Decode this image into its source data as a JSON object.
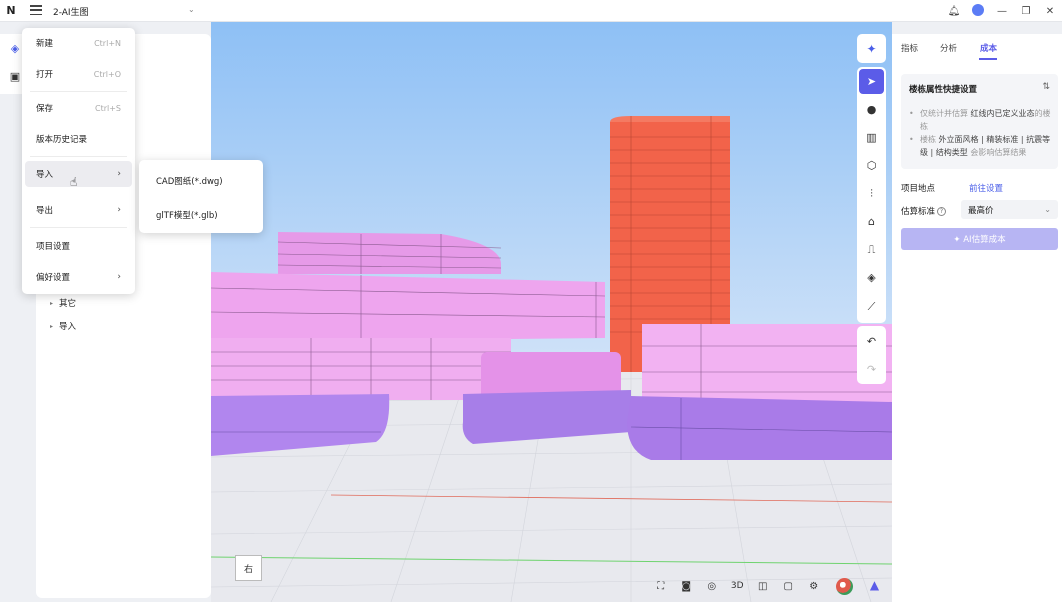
{
  "app": {
    "logo": "N",
    "project_title": "2-AI生图"
  },
  "titlebar_icons": [
    "bell-icon",
    "user-avatar",
    "minimize-icon",
    "maximize-icon",
    "close-icon"
  ],
  "left_tree": {
    "items": [
      {
        "label": "其它"
      },
      {
        "label": "导入"
      }
    ]
  },
  "main_menu": {
    "items": [
      {
        "label": "新建",
        "shortcut": "Ctrl+N"
      },
      {
        "label": "打开",
        "shortcut": "Ctrl+O"
      },
      {
        "label": "保存",
        "shortcut": "Ctrl+S"
      },
      {
        "label": "版本历史记录",
        "shortcut": ""
      },
      {
        "label": "导入",
        "shortcut": "",
        "submenu": true
      },
      {
        "label": "导出",
        "shortcut": "",
        "submenu": true
      },
      {
        "label": "项目设置",
        "shortcut": ""
      },
      {
        "label": "偏好设置",
        "shortcut": "",
        "submenu": true
      }
    ],
    "arrow": "›"
  },
  "import_submenu": {
    "items": [
      {
        "label": "CAD图纸(*.dwg)"
      },
      {
        "label": "glTF模型(*.glb)"
      }
    ]
  },
  "right_panel": {
    "tabs": [
      {
        "label": "指标"
      },
      {
        "label": "分析"
      },
      {
        "label": "成本",
        "active": true
      }
    ],
    "card": {
      "title": "楼栋属性快捷设置",
      "bullet1_a": "仅统计并估算 ",
      "bullet1_b": "红线内已定义业态",
      "bullet1_c": "的楼栋",
      "bullet2_a": "楼栋 ",
      "bullet2_b": "外立面风格 | 精装标准 | 抗震等级 | 结构类型",
      "bullet2_c": " 会影响估算结果"
    },
    "project_location_label": "项目地点",
    "project_location_link": "前往设置",
    "estimate_standard_label": "估算标准",
    "estimate_standard_value": "最高价",
    "ai_button": "✦ AI估算成本"
  },
  "viewport": {
    "view_label": "右",
    "bottom_tools": [
      "fit-icon",
      "camera-icon",
      "screenshot-icon",
      "3D",
      "cube-icon",
      "frame-icon",
      "settings-icon"
    ]
  },
  "colors": {
    "accent": "#5b5ce8",
    "sky_top": "#8ec0f5",
    "ground": "#e8e9ee",
    "tower": "#f2634a",
    "pink_building": "#eea5ee",
    "purple_podium": "#b186ee"
  }
}
